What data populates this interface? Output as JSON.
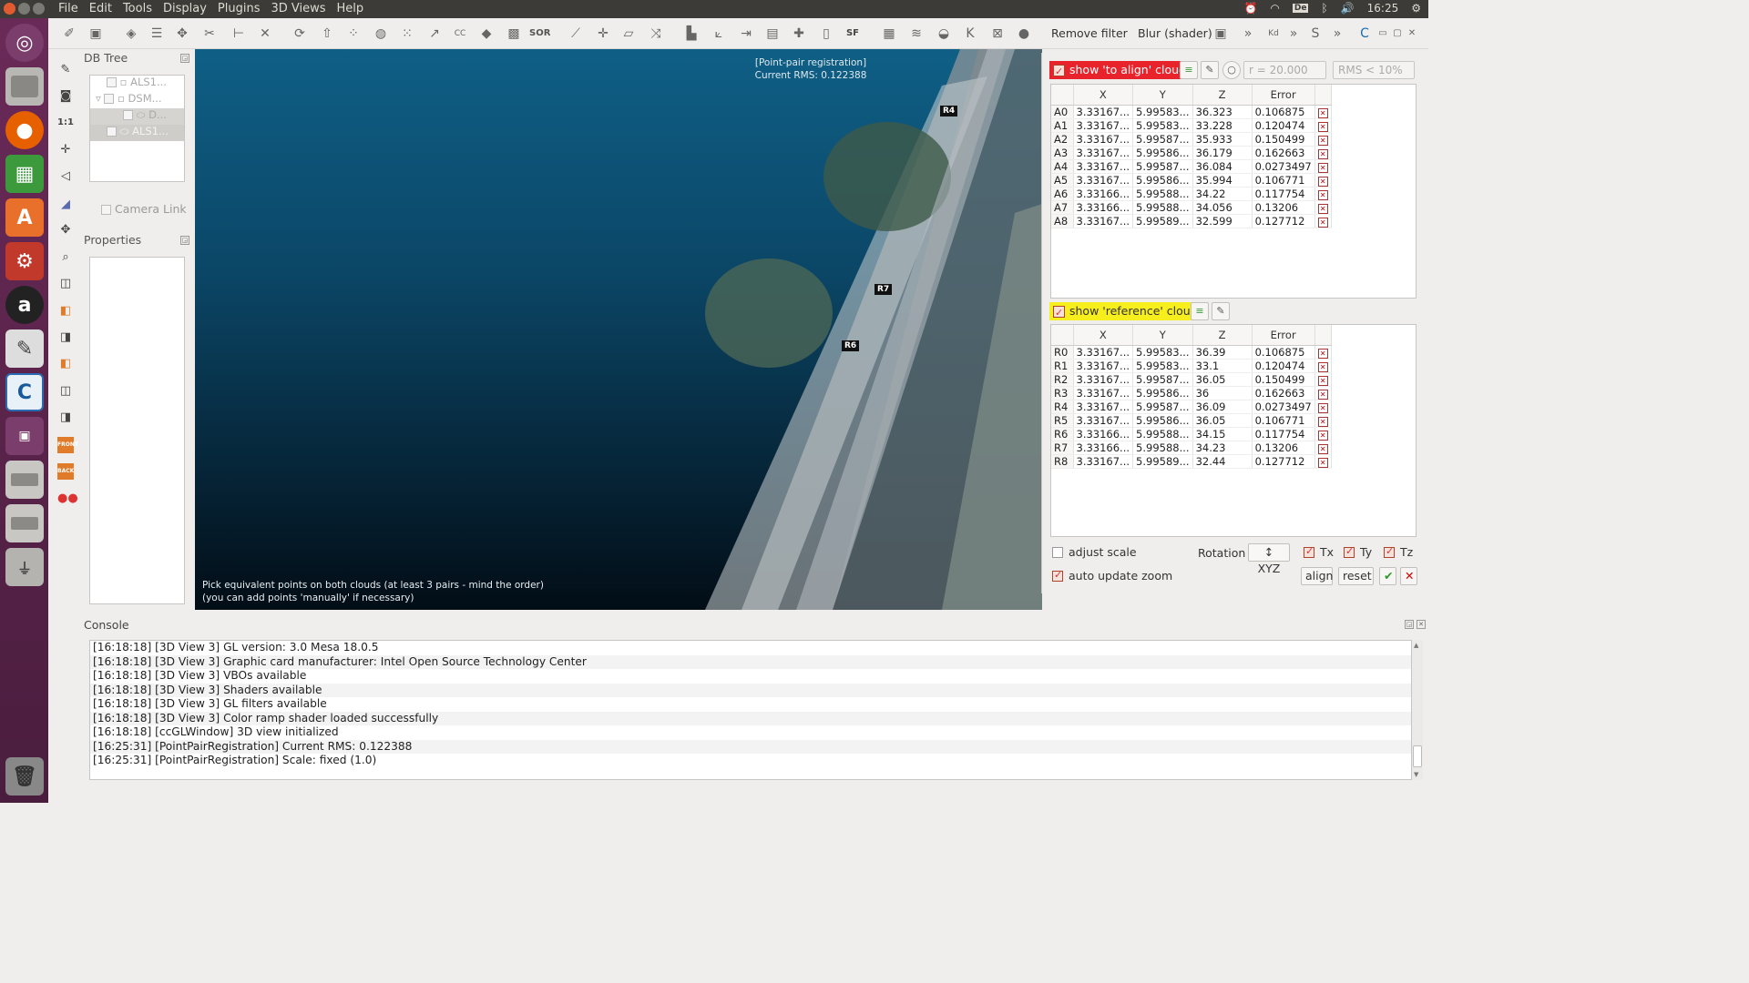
{
  "menubar": {
    "items": [
      "File",
      "Edit",
      "Tools",
      "Display",
      "Plugins",
      "3D Views",
      "Help"
    ]
  },
  "tray": {
    "keyboard": "De",
    "time": "16:25"
  },
  "toolbar": {
    "remove_filter": "Remove filter",
    "blur_shader": "Blur (shader)",
    "sf_label": "SF",
    "sor_label": "SOR",
    "kd_label": "Kd"
  },
  "left_tools": {
    "one_to_one": "1:1",
    "front": "FRONT",
    "back": "BACK"
  },
  "db_tree": {
    "title": "DB Tree",
    "items": [
      "ALS1...",
      "DSM...",
      "D...",
      "ALS1..."
    ]
  },
  "camera_link": "Camera Link",
  "properties": {
    "title": "Properties"
  },
  "view3d": {
    "info_line1": "[Point-pair registration]",
    "info_line2": "Current RMS: 0.122388",
    "hint_line1": "Pick equivalent points on both clouds (at least 3 pairs - mind the order)",
    "hint_line2": "(you can add points 'manually' if necessary)",
    "markers": [
      "R4",
      "R7",
      "R6"
    ]
  },
  "registration": {
    "align_toggle": "show 'to align' cloud",
    "radius": "r = 20.000",
    "rms_filter": "RMS < 10%",
    "ref_toggle": "show 'reference' cloud",
    "columns": [
      "X",
      "Y",
      "Z",
      "Error"
    ],
    "align_points": [
      [
        "A0",
        "3.33167...",
        "5.99583...",
        "36.323",
        "0.106875"
      ],
      [
        "A1",
        "3.33167...",
        "5.99583...",
        "33.228",
        "0.120474"
      ],
      [
        "A2",
        "3.33167...",
        "5.99587...",
        "35.933",
        "0.150499"
      ],
      [
        "A3",
        "3.33167...",
        "5.99586...",
        "36.179",
        "0.162663"
      ],
      [
        "A4",
        "3.33167...",
        "5.99587...",
        "36.084",
        "0.0273497"
      ],
      [
        "A5",
        "3.33167...",
        "5.99586...",
        "35.994",
        "0.106771"
      ],
      [
        "A6",
        "3.33166...",
        "5.99588...",
        "34.22",
        "0.117754"
      ],
      [
        "A7",
        "3.33166...",
        "5.99588...",
        "34.056",
        "0.13206"
      ],
      [
        "A8",
        "3.33167...",
        "5.99589...",
        "32.599",
        "0.127712"
      ]
    ],
    "ref_points": [
      [
        "R0",
        "3.33167...",
        "5.99583...",
        "36.39",
        "0.106875"
      ],
      [
        "R1",
        "3.33167...",
        "5.99583...",
        "33.1",
        "0.120474"
      ],
      [
        "R2",
        "3.33167...",
        "5.99587...",
        "36.05",
        "0.150499"
      ],
      [
        "R3",
        "3.33167...",
        "5.99586...",
        "36",
        "0.162663"
      ],
      [
        "R4",
        "3.33167...",
        "5.99587...",
        "36.09",
        "0.0273497"
      ],
      [
        "R5",
        "3.33167...",
        "5.99586...",
        "36.05",
        "0.106771"
      ],
      [
        "R6",
        "3.33166...",
        "5.99588...",
        "34.15",
        "0.117754"
      ],
      [
        "R7",
        "3.33166...",
        "5.99588...",
        "34.23",
        "0.13206"
      ],
      [
        "R8",
        "3.33167...",
        "5.99589...",
        "32.44",
        "0.127712"
      ]
    ],
    "adjust_scale": "adjust scale",
    "rotation_label": "Rotation",
    "rotation_value": "XYZ",
    "tx": "Tx",
    "ty": "Ty",
    "tz": "Tz",
    "auto_zoom": "auto update zoom",
    "align_btn": "align",
    "reset_btn": "reset"
  },
  "console": {
    "title": "Console",
    "lines": [
      "[16:18:18] [3D View 3] GL version: 3.0 Mesa 18.0.5",
      "[16:18:18] [3D View 3] Graphic card manufacturer: Intel Open Source Technology Center",
      "[16:18:18] [3D View 3] VBOs available",
      "[16:18:18] [3D View 3] Shaders available",
      "[16:18:18] [3D View 3] GL filters available",
      "[16:18:18] [3D View 3] Color ramp shader loaded successfully",
      "[16:18:18] [ccGLWindow] 3D view initialized",
      "[16:25:31] [PointPairRegistration] Current RMS: 0.122388",
      "[16:25:31] [PointPairRegistration] Scale: fixed (1.0)"
    ]
  },
  "colors": {
    "align_red": "#e8232c",
    "ref_yellow": "#f7ee1e",
    "launcher": "#5a2450"
  }
}
